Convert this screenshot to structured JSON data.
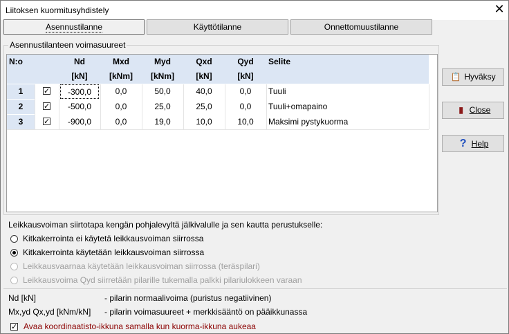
{
  "window": {
    "title": "Liitoksen kuormitusyhdistely",
    "close": "✕"
  },
  "tabs": [
    {
      "label": "Asennustilanne",
      "active": true
    },
    {
      "label": "Käyttötilanne",
      "active": false
    },
    {
      "label": "Onnettomuustilanne",
      "active": false
    }
  ],
  "group": {
    "label": "Asennustilanteen voimasuureet"
  },
  "table": {
    "headers": [
      "N:o",
      "",
      "Nd",
      "Mxd",
      "Myd",
      "Qxd",
      "Qyd",
      "Selite"
    ],
    "units": [
      "",
      "",
      "[kN]",
      "[kNm]",
      "[kNm]",
      "[kN]",
      "[kN]",
      ""
    ],
    "rows": [
      {
        "no": "1",
        "checked": "✓",
        "nd": "-300,0",
        "mxd": "0,0",
        "myd": "50,0",
        "qxd": "40,0",
        "qyd": "0,0",
        "selite": "Tuuli"
      },
      {
        "no": "2",
        "checked": "✓",
        "nd": "-500,0",
        "mxd": "0,0",
        "myd": "25,0",
        "qxd": "25,0",
        "qyd": "0,0",
        "selite": "Tuuli+omapaino"
      },
      {
        "no": "3",
        "checked": "✓",
        "nd": "-900,0",
        "mxd": "0,0",
        "myd": "19,0",
        "qxd": "10,0",
        "qyd": "10,0",
        "selite": "Maksimi pystykuorma"
      }
    ]
  },
  "buttons": {
    "accept": "Hyväksy",
    "close": "Close",
    "help": "Help"
  },
  "transfer": {
    "heading": "Leikkausvoiman siirtotapa kengän pohjalevyltä jälkivalulle ja sen kautta perustukselle:",
    "options": [
      {
        "label": "Kitkakerrointa ei käytetä leikkausvoiman siirrossa",
        "selected": false,
        "enabled": true
      },
      {
        "label": "Kitkakerrointa käytetään leikkausvoiman siirrossa",
        "selected": true,
        "enabled": true
      },
      {
        "label": "Leikkausvaarnaa käytetään leikkausvoiman siirrossa (teräspilari)",
        "selected": false,
        "enabled": false
      },
      {
        "label": "Leikkausvoima Qyd siirretään pilarille tukemalla palkki pilariulokkeen varaan",
        "selected": false,
        "enabled": false
      }
    ]
  },
  "legend": [
    {
      "term": "Nd [kN]",
      "desc": "- pilarin normaalivoima (puristus negatiivinen)"
    },
    {
      "term": "Mx,yd Qx,yd [kNm/kN]",
      "desc": "- pilarin voimasuureet + merkkisääntö on pääikkunassa"
    }
  ],
  "coord_checkbox": {
    "label": "Avaa koordinaatisto-ikkuna samalla kun kuorma-ikkuna aukeaa",
    "checked": "✓",
    "color": "#8b0000"
  }
}
